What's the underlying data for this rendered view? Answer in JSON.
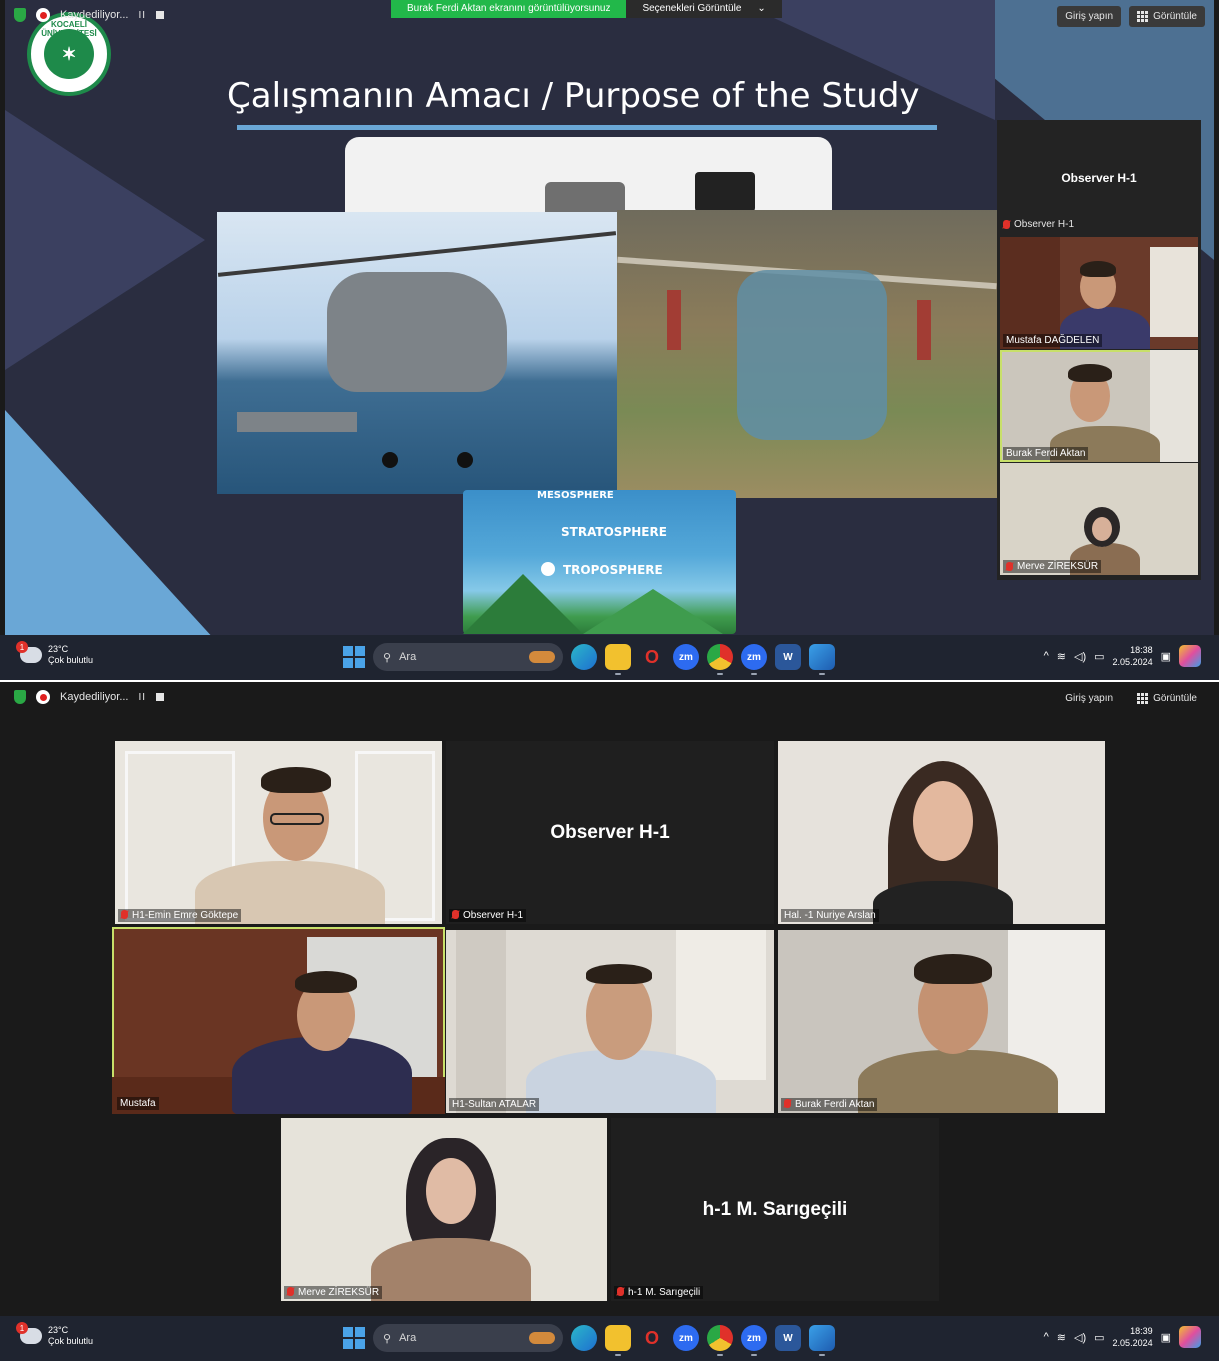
{
  "zoom_top": {
    "recording": "Kaydediliyor...",
    "share_banner": "Burak Ferdi Aktan ekranını görüntülüyorsunuz",
    "view_options": "Seçenekleri Görüntüle",
    "view_options_chevron": "⌄",
    "signin": "Giriş yapın",
    "view": "Görüntüle",
    "pause_glyph": "II"
  },
  "slide": {
    "title": "Çalışmanın Amacı / Purpose of the Study",
    "logo_ring_text": "KOCAELİ ÜNİVERSİTESİ",
    "layers": [
      "MESOSPHERE",
      "STRATOSPHERE",
      "TROPOSPHERE"
    ]
  },
  "side_panel": {
    "header_title": "Observer H-1",
    "header_name": "Observer H-1",
    "tiles": [
      {
        "name": "Mustafa DAĞDELEN"
      },
      {
        "name": "Burak Ferdi Aktan"
      },
      {
        "name": "Merve ZİREKSÜR"
      }
    ]
  },
  "gallery": {
    "tiles": [
      {
        "name": "H1-Emin Emre Göktepe"
      },
      {
        "name": "Observer H-1",
        "display": "Observer H-1"
      },
      {
        "name": "Hal. -1 Nuriye Arslan"
      },
      {
        "name": "Mustafa"
      },
      {
        "name": "H1-Sultan ATALAR"
      },
      {
        "name": "Burak Ferdi Aktan"
      },
      {
        "name": "Merve ZİREKSÜR"
      },
      {
        "name": "h-1 M. Sarıgeçili",
        "display": "h-1 M. Sarıgeçili"
      }
    ]
  },
  "taskbar1": {
    "temp": "23°C",
    "weather": "Çok bulutlu",
    "weather_badge": "1",
    "search": "Ara",
    "time": "18:38",
    "date": "2.05.2024"
  },
  "taskbar2": {
    "temp": "23°C",
    "weather": "Çok bulutlu",
    "weather_badge": "1",
    "search": "Ara",
    "time": "18:39",
    "date": "2.05.2024"
  },
  "taskbar_icons": {
    "zoom1": "zm",
    "zoom2": "zm",
    "word": "W",
    "opera": "O"
  },
  "colors": {
    "slide_bg": "#2a2d40",
    "accent_blue": "#6aa7d6",
    "share_green": "#22b84a",
    "active_speaker": "#c8e06a",
    "muted_red": "#e0312a"
  }
}
